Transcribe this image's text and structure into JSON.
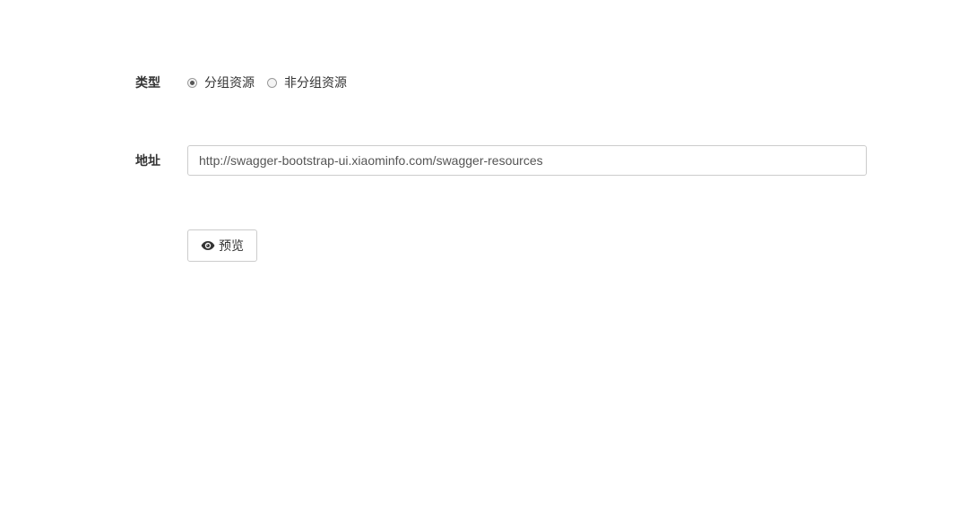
{
  "form": {
    "type_label": "类型",
    "type_options": [
      {
        "label": "分组资源",
        "checked": true
      },
      {
        "label": "非分组资源",
        "checked": false
      }
    ],
    "url_label": "地址",
    "url_value": "http://swagger-bootstrap-ui.xiaominfo.com/swagger-resources",
    "preview_button": {
      "label": "预览",
      "icon": "eye-icon"
    }
  }
}
